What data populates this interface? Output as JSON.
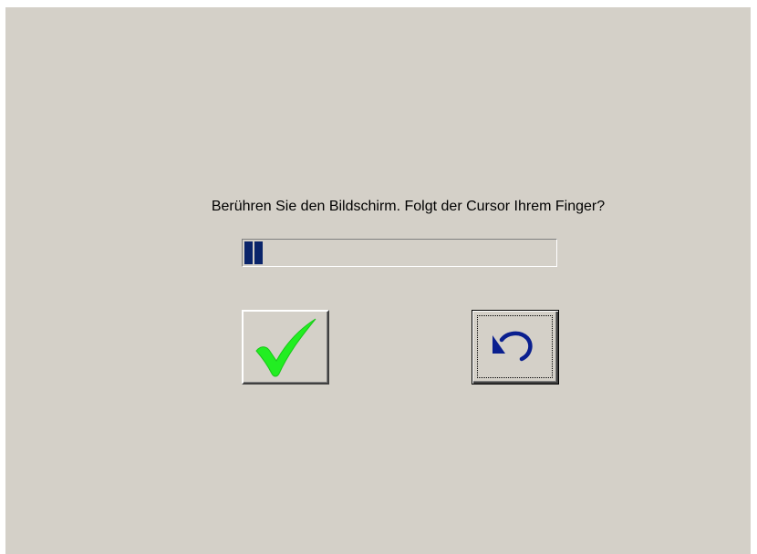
{
  "dialog": {
    "prompt": "Berühren Sie den Bildschirm. Folgt der Cursor Ihrem Finger?",
    "progress": {
      "filled_blocks": 2,
      "block_color": "#0a246a"
    },
    "buttons": {
      "confirm_icon": "checkmark-icon",
      "confirm_icon_color": "#22ee22",
      "undo_icon": "undo-arrow-icon",
      "undo_icon_color": "#0a1f8f"
    },
    "background_color": "#d4d0c8"
  }
}
